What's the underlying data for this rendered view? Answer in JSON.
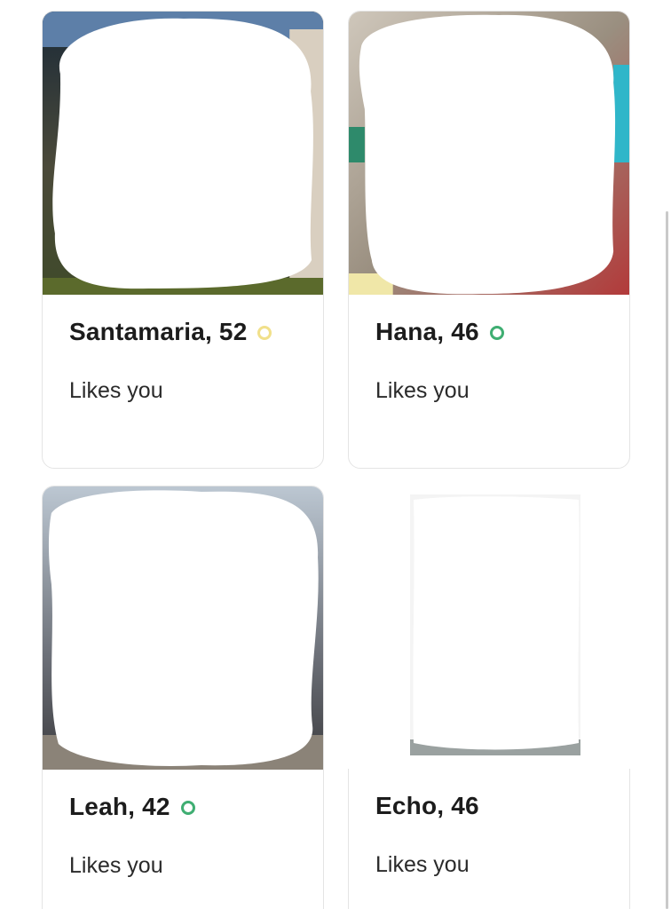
{
  "profiles": [
    {
      "name_age": "Santamaria, 52",
      "subtitle": "Likes you",
      "status": "away"
    },
    {
      "name_age": "Hana, 46",
      "subtitle": "Likes you",
      "status": "online"
    },
    {
      "name_age": "Leah, 42",
      "subtitle": "Likes you",
      "status": "online"
    },
    {
      "name_age": "Echo, 46",
      "subtitle": "Likes you",
      "status": "none"
    }
  ],
  "colors": {
    "online_dot": "#3fae72",
    "away_dot": "#f1e08a",
    "card_border": "#e4e4e4"
  }
}
